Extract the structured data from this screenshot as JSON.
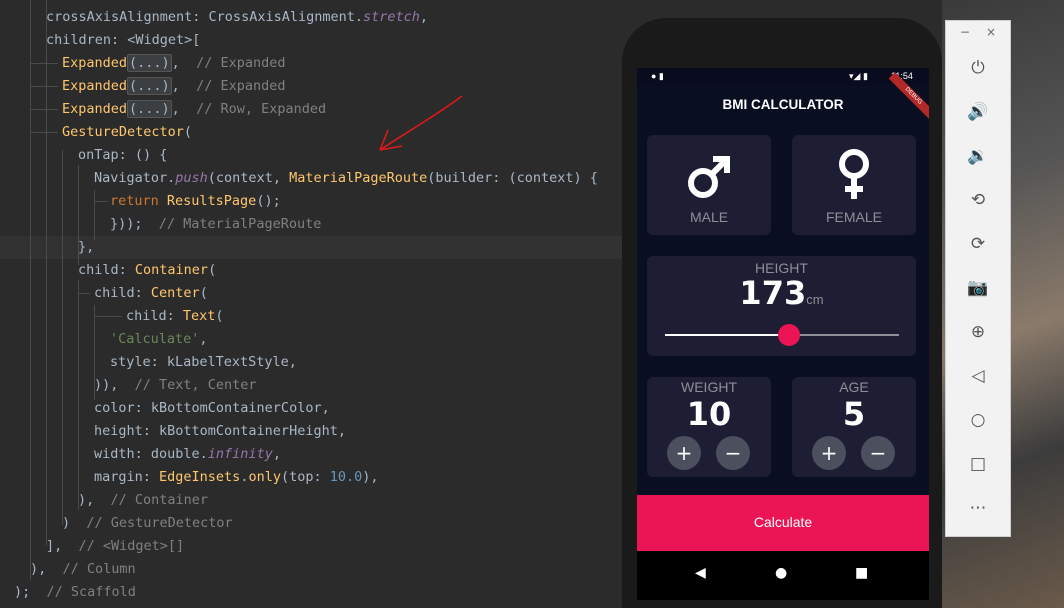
{
  "editor": {
    "lines": [
      [
        [
          "crossAxisAlignment: CrossAxisAlignment.",
          "p"
        ],
        [
          "stretch",
          "it"
        ],
        [
          ",",
          "p"
        ]
      ],
      [
        [
          "children: <Widget>[",
          "p"
        ]
      ],
      [
        [
          "Expanded",
          "fn"
        ],
        [
          "(...)",
          "box"
        ],
        [
          ",  ",
          "p"
        ],
        [
          "// Expanded",
          "cm"
        ]
      ],
      [
        [
          "Expanded",
          "fn"
        ],
        [
          "(...)",
          "box"
        ],
        [
          ",  ",
          "p"
        ],
        [
          "// Expanded",
          "cm"
        ]
      ],
      [
        [
          "Expanded",
          "fn"
        ],
        [
          "(...)",
          "box"
        ],
        [
          ",  ",
          "p"
        ],
        [
          "// Row, Expanded",
          "cm"
        ]
      ],
      [
        [
          "GestureDetector",
          "fn"
        ],
        [
          "(",
          "p"
        ]
      ],
      [
        [
          "onTap: () {",
          "p"
        ]
      ],
      [
        [
          "Navigator.",
          "p"
        ],
        [
          "push",
          "it"
        ],
        [
          "(context, ",
          "p"
        ],
        [
          "MaterialPageRoute",
          "fn"
        ],
        [
          "(builder: (context) {",
          "p"
        ]
      ],
      [
        [
          "return ",
          "kw"
        ],
        [
          "ResultsPage",
          "fn"
        ],
        [
          "();",
          "p"
        ]
      ],
      [
        [
          "}));  ",
          "p"
        ],
        [
          "// MaterialPageRoute",
          "cm"
        ]
      ],
      [
        [
          "},",
          "p"
        ]
      ],
      [
        [
          "child: ",
          "p"
        ],
        [
          "Container",
          "fn"
        ],
        [
          "(",
          "p"
        ]
      ],
      [
        [
          "child: ",
          "p"
        ],
        [
          "Center",
          "fn"
        ],
        [
          "(",
          "p"
        ]
      ],
      [
        [
          "child: ",
          "p"
        ],
        [
          "Text",
          "fn"
        ],
        [
          "(",
          "p"
        ]
      ],
      [
        [
          "'Calculate'",
          "str"
        ],
        [
          ",",
          "p"
        ]
      ],
      [
        [
          "style: kLabelTextStyle,",
          "p"
        ]
      ],
      [
        [
          ")),  ",
          "p"
        ],
        [
          "// Text, Center",
          "cm"
        ]
      ],
      [
        [
          "color: kBottomContainerColor,",
          "p"
        ]
      ],
      [
        [
          "height: kBottomContainerHeight,",
          "p"
        ]
      ],
      [
        [
          "width: double.",
          "p"
        ],
        [
          "infinity",
          "it"
        ],
        [
          ",",
          "p"
        ]
      ],
      [
        [
          "margin: ",
          "p"
        ],
        [
          "EdgeInsets",
          "fn"
        ],
        [
          ".",
          "p"
        ],
        [
          "only",
          "fn"
        ],
        [
          "(top: ",
          "p"
        ],
        [
          "10.0",
          "num"
        ],
        [
          "),",
          "p"
        ]
      ],
      [
        [
          "),  ",
          "p"
        ],
        [
          "// Container",
          "cm"
        ]
      ],
      [
        [
          ")  ",
          "p"
        ],
        [
          "// GestureDetector",
          "cm"
        ]
      ],
      [
        [
          "],  ",
          "p"
        ],
        [
          "// <Widget>[]",
          "cm"
        ]
      ],
      [
        [
          "),  ",
          "p"
        ],
        [
          "// Column",
          "cm"
        ]
      ],
      [
        [
          ");  ",
          "p"
        ],
        [
          "// Scaffold",
          "cm"
        ]
      ]
    ]
  },
  "phone": {
    "status": {
      "time": "11:54"
    },
    "app_title": "BMI CALCULATOR",
    "debug_banner": "DEBUG",
    "male": {
      "icon": "male-icon",
      "label": "MALE"
    },
    "female": {
      "icon": "female-icon",
      "label": "FEMALE"
    },
    "height": {
      "label": "HEIGHT",
      "value": "173",
      "unit": "cm",
      "min": 120,
      "max": 220
    },
    "weight": {
      "label": "WEIGHT",
      "value": "10",
      "plus": "+",
      "minus": "−"
    },
    "age": {
      "label": "AGE",
      "value": "5",
      "plus": "+",
      "minus": "−"
    },
    "calculate": "Calculate",
    "colors": {
      "accent": "#eb1555",
      "card": "#1d1e33",
      "background": "#0a0e21",
      "label": "#8d8e98"
    }
  },
  "emulator_toolbar": {
    "top": [
      "−",
      "×"
    ],
    "buttons": [
      {
        "name": "power-icon",
        "glyph": "⏻"
      },
      {
        "name": "volume-up-icon",
        "glyph": "🔊"
      },
      {
        "name": "volume-down-icon",
        "glyph": "🔉"
      },
      {
        "name": "rotate-left-icon",
        "glyph": "⟲"
      },
      {
        "name": "rotate-right-icon",
        "glyph": "⟳"
      },
      {
        "name": "camera-icon",
        "glyph": "📷"
      },
      {
        "name": "zoom-icon",
        "glyph": "⊕"
      },
      {
        "name": "back-icon",
        "glyph": "◁"
      },
      {
        "name": "home-icon",
        "glyph": "○"
      },
      {
        "name": "overview-icon",
        "glyph": "□"
      },
      {
        "name": "more-icon",
        "glyph": "⋯"
      }
    ]
  }
}
